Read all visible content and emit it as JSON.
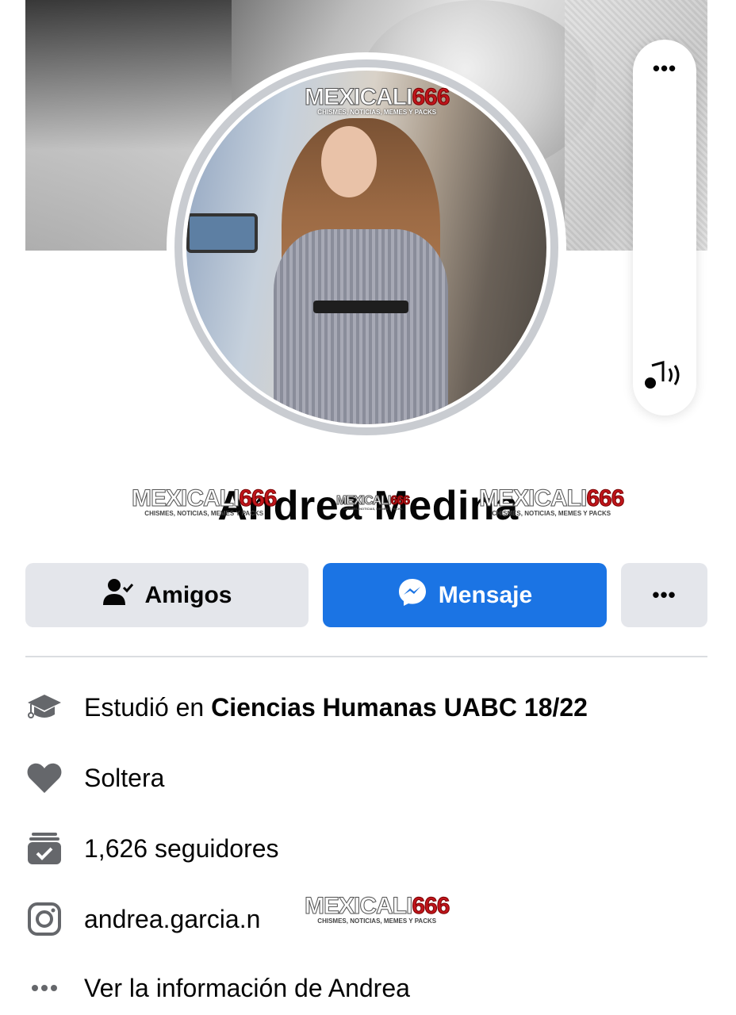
{
  "watermark": {
    "brand_a": "MEXICALI",
    "brand_b": "666",
    "tagline": "CHISMES, NOTICIAS, MEMES Y PACKS"
  },
  "profile": {
    "name": "Andrea Medina"
  },
  "side_controls": {
    "more_icon": "more-horizontal-icon",
    "sound_icon": "music-sound-icon"
  },
  "actions": {
    "friends_label": "Amigos",
    "message_label": "Mensaje",
    "more_label": "•••"
  },
  "info": {
    "study_prefix": "Estudió en ",
    "study_place": "Ciencias Humanas UABC 18/22",
    "relationship": "Soltera",
    "followers": "1,626 seguidores",
    "instagram": "andrea.garcia.n",
    "about_link": "Ver la información de Andrea"
  },
  "colors": {
    "primary": "#1b74e4",
    "button_grey": "#e4e6eb",
    "icon_grey": "#65676b",
    "watermark_red": "#c0151b"
  }
}
